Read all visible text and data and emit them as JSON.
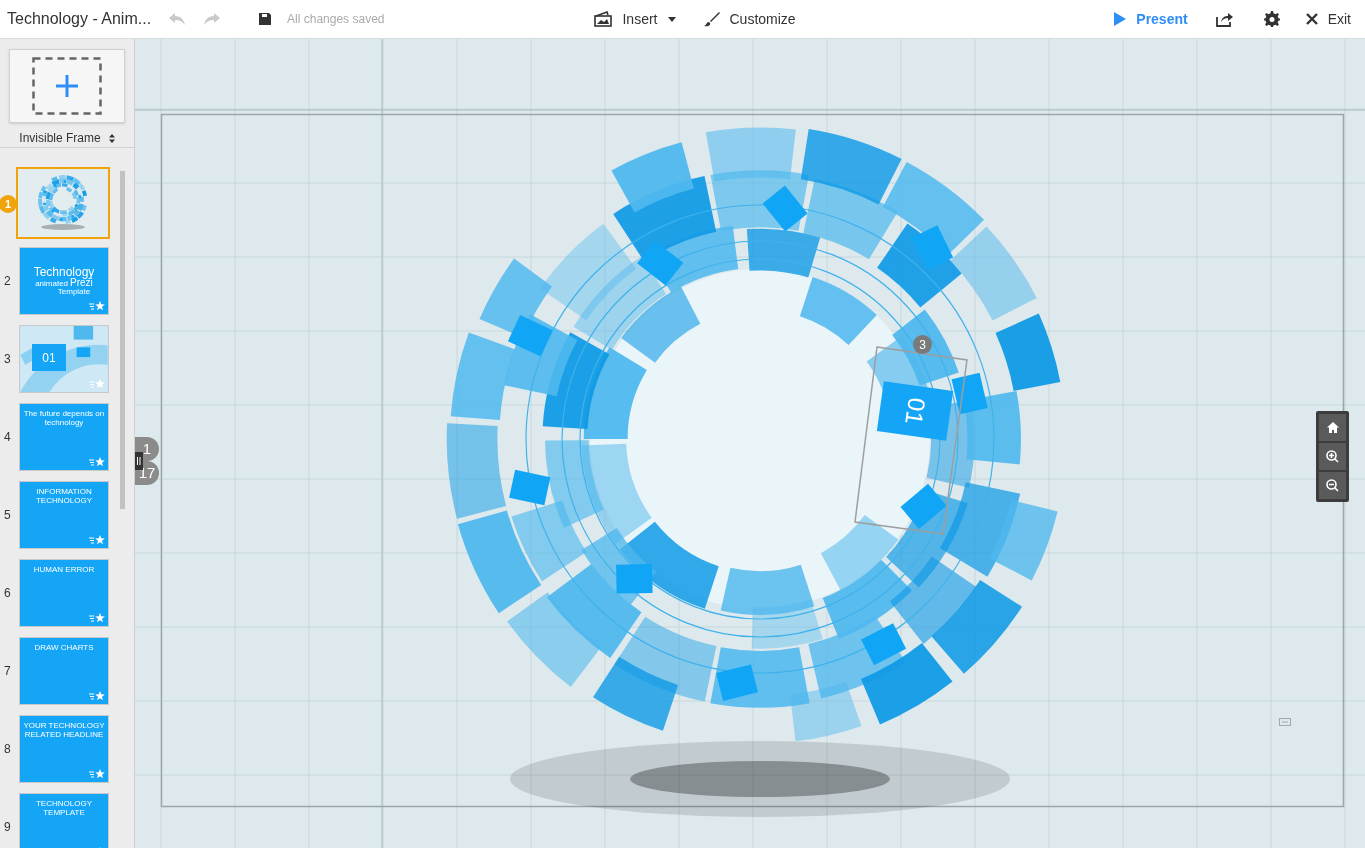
{
  "document": {
    "title": "Technology - Anim..."
  },
  "toolbar": {
    "save_status": "All changes saved",
    "insert": "Insert",
    "customize": "Customize",
    "present": "Present",
    "exit": "Exit"
  },
  "frame_picker": {
    "label": "Invisible Frame"
  },
  "slides": [
    {
      "number": "1",
      "selected": true,
      "kind": "artwork"
    },
    {
      "number": "2",
      "selected": false,
      "kind": "title",
      "lines": [
        "Technology",
        "animated",
        "Prezi",
        "Template"
      ]
    },
    {
      "number": "3",
      "selected": false,
      "kind": "section",
      "heading": "01"
    },
    {
      "number": "4",
      "selected": false,
      "kind": "heading",
      "heading": "The future depends on technology"
    },
    {
      "number": "5",
      "selected": false,
      "kind": "heading",
      "heading": "INFORMATION TECHNOLOGY"
    },
    {
      "number": "6",
      "selected": false,
      "kind": "heading",
      "heading": "HUMAN ERROR"
    },
    {
      "number": "7",
      "selected": false,
      "kind": "heading",
      "heading": "DRAW CHARTS"
    },
    {
      "number": "8",
      "selected": false,
      "kind": "heading",
      "heading": "YOUR TECHNOLOGY RELATED HEADLINE"
    },
    {
      "number": "9",
      "selected": false,
      "kind": "heading",
      "heading": "TECHNOLOGY TEMPLATE"
    }
  ],
  "path_counter": {
    "current": "1",
    "total": "17"
  },
  "canvas": {
    "frame_number": "3",
    "frame_label": "01"
  }
}
